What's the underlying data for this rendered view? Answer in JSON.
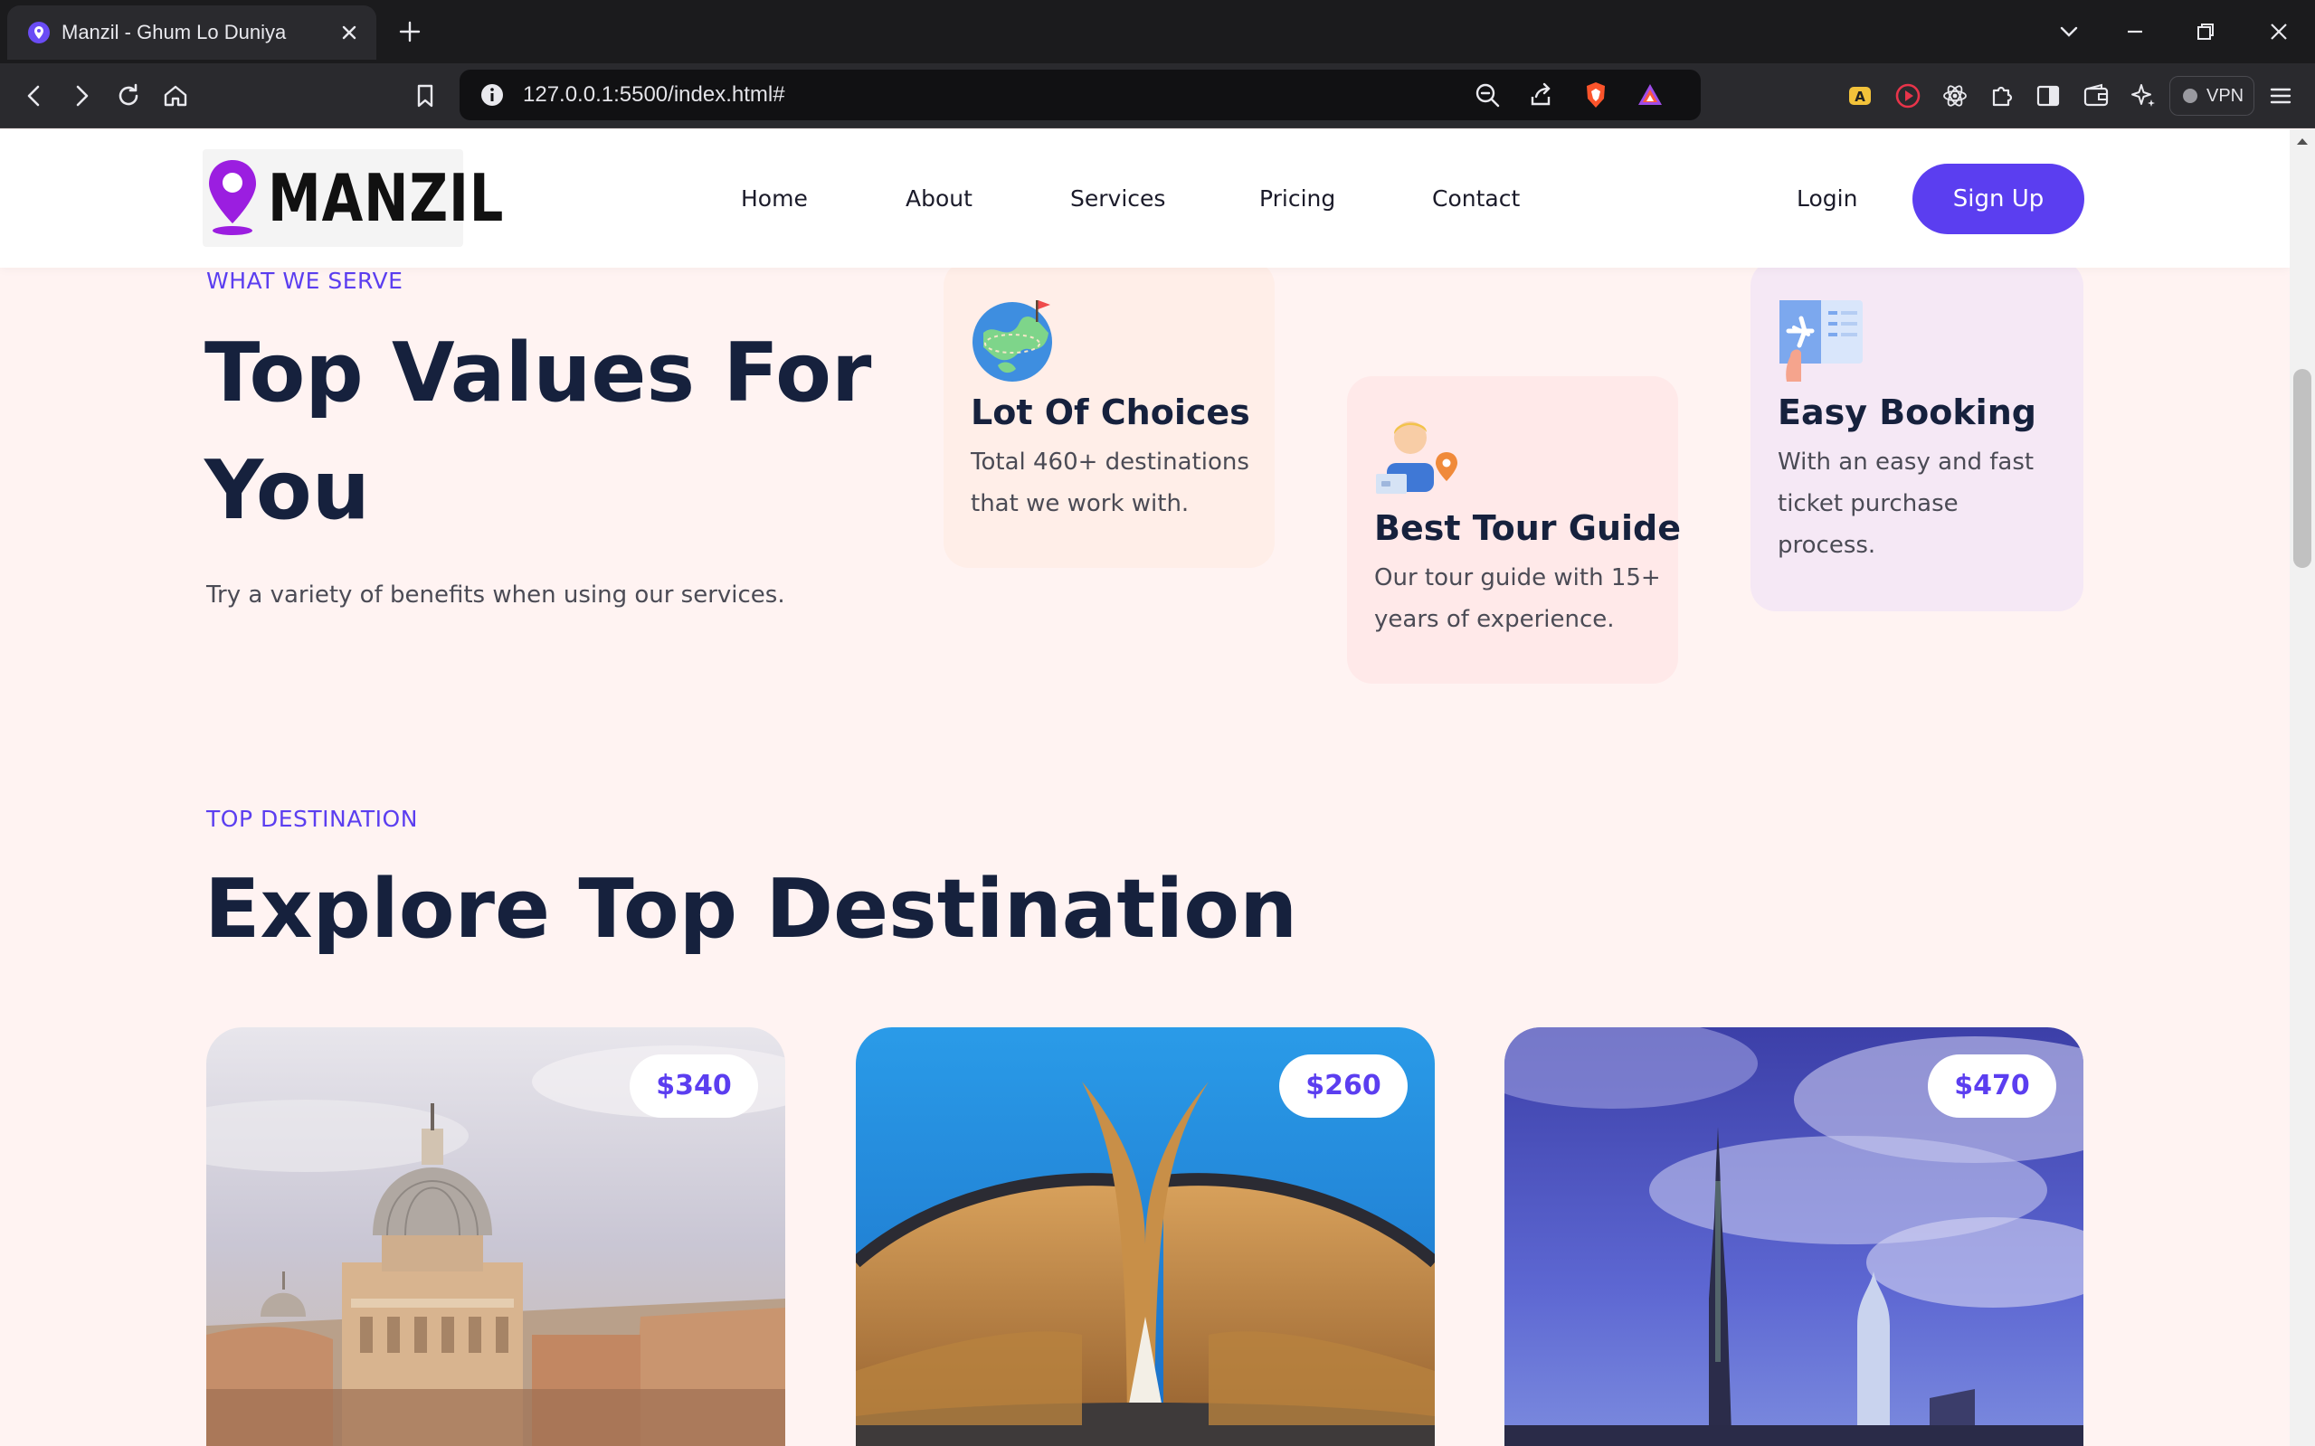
{
  "browser": {
    "tab_title": "Manzil - Ghum Lo Duniya",
    "url": "127.0.0.1:5500/index.html#",
    "vpn_label": "VPN"
  },
  "header": {
    "logo_text": "MANZIL",
    "nav": [
      "Home",
      "About",
      "Services",
      "Pricing",
      "Contact"
    ],
    "login": "Login",
    "signup": "Sign Up"
  },
  "serve": {
    "eyebrow": "WHAT WE SERVE",
    "title": "Top Values For You",
    "subtitle": "Try a variety of benefits when using our services.",
    "cards": [
      {
        "title": "Lot Of Choices",
        "text": "Total 460+ destinations that we work with.",
        "icon": "globe-icon",
        "bg": "#ffeee8"
      },
      {
        "title": "Best Tour Guide",
        "text": "Our tour guide with 15+ years of experience.",
        "icon": "tour-guide-icon",
        "bg": "#ffe9e9"
      },
      {
        "title": "Easy Booking",
        "text": "With an easy and fast ticket purchase process.",
        "icon": "ticket-icon",
        "bg": "#f5e8f5"
      }
    ]
  },
  "destinations": {
    "eyebrow": "TOP DESTINATION",
    "title": "Explore Top Destination",
    "items": [
      {
        "price": "$340",
        "scene": "rome-dome-photo"
      },
      {
        "price": "$260",
        "scene": "pakistan-monument-photo"
      },
      {
        "price": "$470",
        "scene": "dubai-burj-khalifa-photo"
      }
    ]
  },
  "colors": {
    "accent": "#5b3ef0",
    "page_bg": "#fff3f2",
    "heading": "#16213d"
  }
}
